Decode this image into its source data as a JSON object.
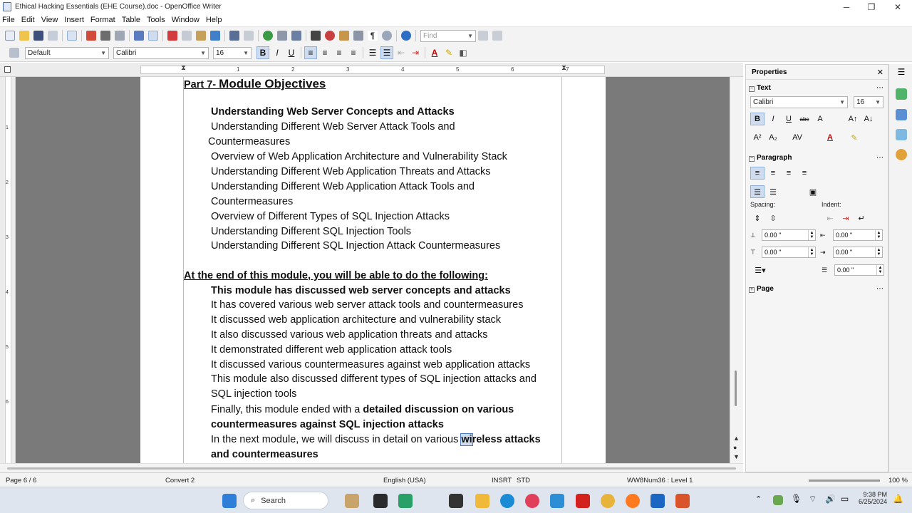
{
  "window": {
    "title": "Ethical Hacking Essentials (EHE Course).doc - OpenOffice Writer",
    "minimize": "─",
    "maximize": "❐",
    "close": "✕"
  },
  "menu": [
    "File",
    "Edit",
    "View",
    "Insert",
    "Format",
    "Table",
    "Tools",
    "Window",
    "Help"
  ],
  "toolbar": {
    "find_placeholder": "Find"
  },
  "formatting": {
    "style": "Default",
    "font": "Calibri",
    "size": "16",
    "bold": "B",
    "italic": "I",
    "underline": "U"
  },
  "ruler": {
    "h_numbers": [
      "1",
      "2",
      "3",
      "4",
      "5",
      "6",
      "7"
    ],
    "v_numbers": [
      "1",
      "2",
      "3",
      "4",
      "5",
      "6"
    ]
  },
  "document": {
    "heading_prefix": "Part 7- ",
    "heading_main": "Module Objectives",
    "objectives": [
      "Understanding Web Server Concepts and Attacks",
      "Understanding Different Web Server Attack Tools and",
      "Countermeasures",
      "Overview of Web Application Architecture and Vulnerability Stack",
      "Understanding Different Web Application Threats and Attacks",
      "Understanding Different Web Application Attack Tools and",
      "Countermeasures",
      "Overview of Different Types of SQL Injection Attacks",
      "Understanding Different SQL Injection Tools",
      "Understanding Different SQL Injection Attack Countermeasures"
    ],
    "subheading": "At the end of this module, you will be able to do the following:",
    "outcomes": [
      "This module has discussed web server concepts and attacks",
      "It has covered various web server attack tools and countermeasures",
      "It discussed web application architecture and vulnerability stack",
      "It also discussed various web application threats and attacks",
      "It demonstrated different web application attack tools",
      "It discussed various countermeasures against web application attacks",
      "This module also discussed different types of SQL injection attacks and",
      "SQL injection tools"
    ],
    "finally_plain": "Finally, this module ended with a ",
    "finally_bold": "detailed discussion on various",
    "finally_line2": "countermeasures against SQL injection attacks",
    "next_plain": "In the next module, we will discuss in detail on various ",
    "next_bold_sel": "wi",
    "next_bold": "reless attacks",
    "next_line2": "and countermeasures"
  },
  "sidebar": {
    "title": "Properties",
    "text_section": "Text",
    "font": "Calibri",
    "size": "16",
    "paragraph_section": "Paragraph",
    "spacing_label": "Spacing:",
    "indent_label": "Indent:",
    "spacing_above": "0.00 \"",
    "spacing_below": "0.00 \"",
    "indent_before": "0.00 \"",
    "indent_after": "0.00 \"",
    "indent_first": "0.00 \"",
    "page_section": "Page"
  },
  "status": {
    "page": "Page 6 / 6",
    "style": "Convert 2",
    "language": "English (USA)",
    "insert": "INSRT",
    "selection": "STD",
    "list": "WW8Num36 : Level 1",
    "zoom": "100 %"
  },
  "taskbar": {
    "search": "Search",
    "time": "9:38 PM",
    "date": "6/25/2024"
  },
  "colors": {
    "selection": "#cfdcef",
    "accent": "#3b6fb6"
  }
}
